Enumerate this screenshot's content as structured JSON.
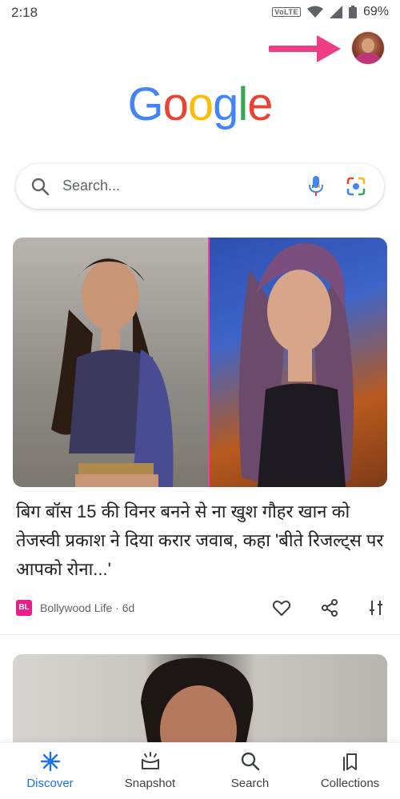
{
  "status_bar": {
    "time": "2:18",
    "network": "VoLTE",
    "battery": "69%"
  },
  "brand": {
    "letters": [
      {
        "ch": "G",
        "color": "#4285F4"
      },
      {
        "ch": "o",
        "color": "#EA4335"
      },
      {
        "ch": "o",
        "color": "#FBBC05"
      },
      {
        "ch": "g",
        "color": "#4285F4"
      },
      {
        "ch": "l",
        "color": "#34A853"
      },
      {
        "ch": "e",
        "color": "#EA4335"
      }
    ]
  },
  "search": {
    "placeholder": "Search..."
  },
  "feed": {
    "card1": {
      "headline": "बिग बॉस 15 की विनर बनने से ना खुश गौहर खान को तेजस्वी प्रकाश ने दिया करार जवाब, कहा 'बीते रिजल्ट्स पर आपको रोना...'",
      "source": "Bollywood Life · 6d",
      "source_logo": "BL"
    }
  },
  "bottom_nav": {
    "items": [
      {
        "label": "Discover",
        "icon": "discover-icon",
        "active": true
      },
      {
        "label": "Snapshot",
        "icon": "snapshot-icon",
        "active": false
      },
      {
        "label": "Search",
        "icon": "search-icon",
        "active": false
      },
      {
        "label": "Collections",
        "icon": "collections-icon",
        "active": false
      }
    ]
  },
  "colors": {
    "accent": "#1a73e8",
    "arrow": "#ee3f86",
    "source_logo": "#e91e8c"
  }
}
